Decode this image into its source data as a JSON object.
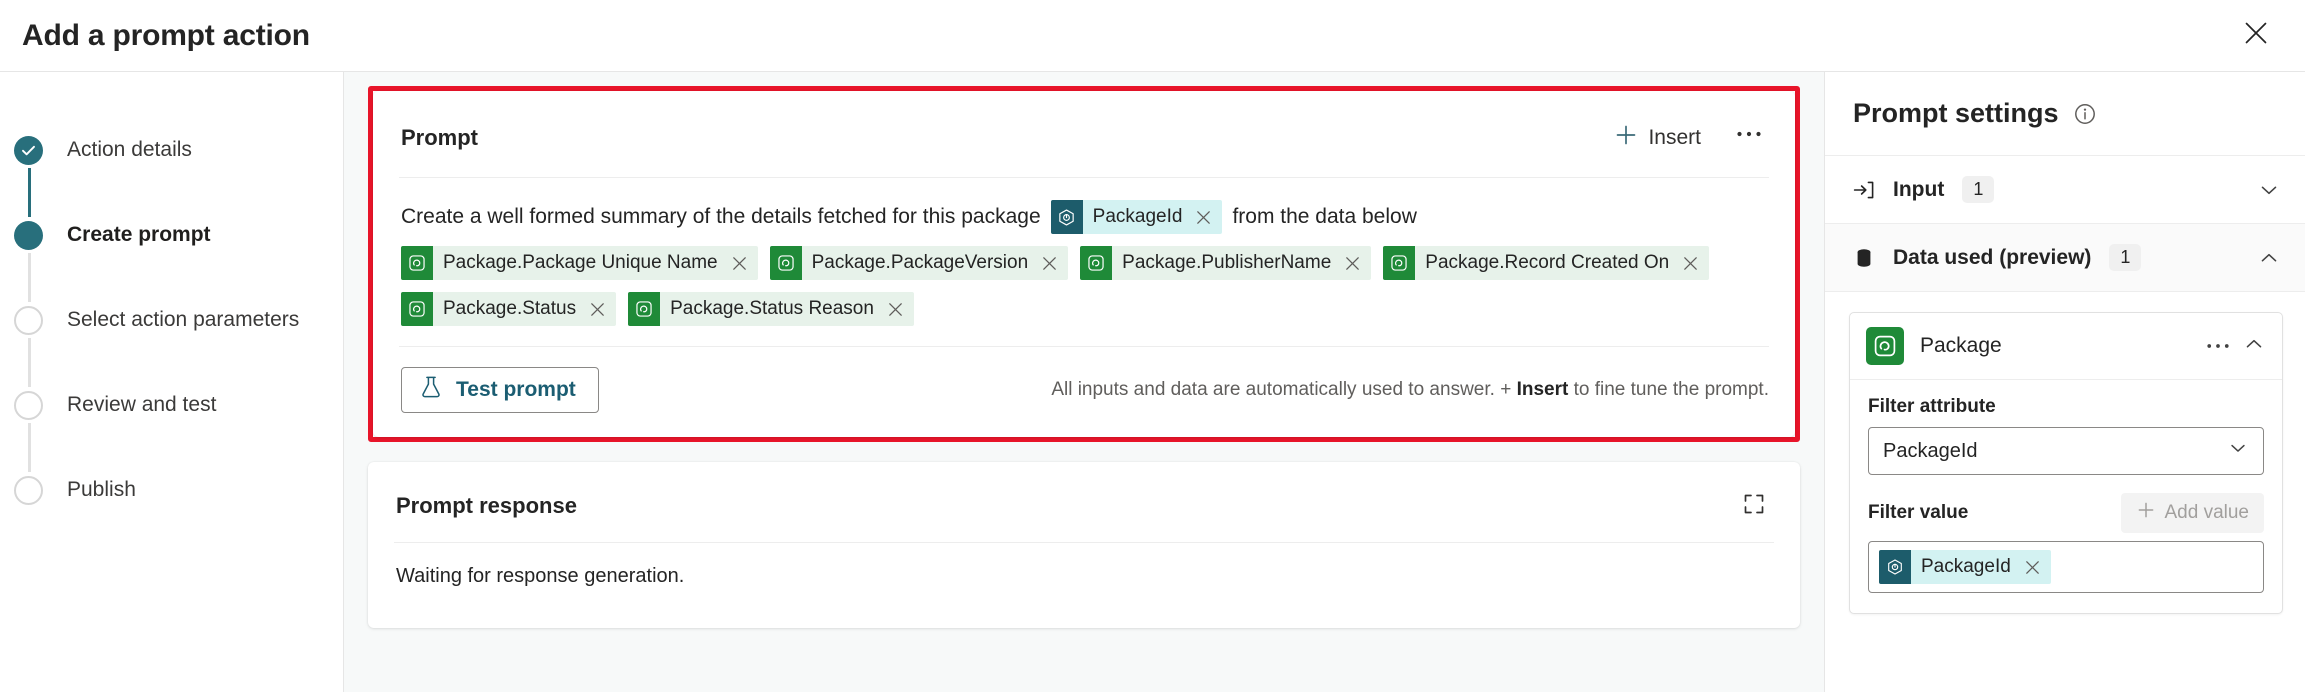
{
  "dialog": {
    "title": "Add a prompt action",
    "close_icon": "close-icon"
  },
  "wizard": {
    "steps": [
      {
        "label": "Action details",
        "state": "done"
      },
      {
        "label": "Create prompt",
        "state": "current"
      },
      {
        "label": "Select action parameters",
        "state": "todo"
      },
      {
        "label": "Review and test",
        "state": "todo"
      },
      {
        "label": "Publish",
        "state": "todo"
      }
    ]
  },
  "prompt_card": {
    "title": "Prompt",
    "insert_label": "Insert",
    "more_label": "···",
    "text_before": "Create a well formed summary of the details fetched for this package",
    "inline_chip": {
      "label": "PackageId",
      "type": "teal"
    },
    "text_after": "from the data below",
    "data_chips": [
      {
        "label": "Package.Package Unique Name",
        "type": "green"
      },
      {
        "label": "Package.PackageVersion",
        "type": "green"
      },
      {
        "label": "Package.PublisherName",
        "type": "green"
      },
      {
        "label": "Package.Record Created On",
        "type": "green"
      },
      {
        "label": "Package.Status",
        "type": "green"
      },
      {
        "label": "Package.Status Reason",
        "type": "green"
      }
    ],
    "test_button": "Test prompt",
    "footnote_part1": "All inputs and data are automatically used to answer. + ",
    "footnote_bold": "Insert",
    "footnote_part2": " to fine tune the prompt."
  },
  "response_card": {
    "title": "Prompt response",
    "expand_icon": "expand-icon",
    "body_text": "Waiting for response generation."
  },
  "settings": {
    "title": "Prompt settings",
    "info_icon": "info-icon",
    "sections": [
      {
        "label": "Input",
        "count": "1",
        "icon": "input-arrow-icon",
        "expanded": false
      },
      {
        "label": "Data used (preview)",
        "count": "1",
        "icon": "database-icon",
        "expanded": true
      }
    ],
    "entity": {
      "name": "Package",
      "icon": "dataverse-table-icon",
      "more_label": "···",
      "filter_attribute_label": "Filter attribute",
      "filter_attribute_value": "PackageId",
      "filter_value_label": "Filter value",
      "add_value_label": "Add value",
      "value_chip": {
        "label": "PackageId",
        "type": "teal"
      }
    }
  },
  "colors": {
    "accent_teal": "#286f7c",
    "highlight_red": "#e8152a",
    "chip_green_bg": "#e7f2ea",
    "chip_green_icon": "#1f8a38",
    "chip_teal_bg": "#d3f2f2",
    "chip_teal_icon": "#1d5c6b",
    "canvas": "#f7f9f9"
  }
}
